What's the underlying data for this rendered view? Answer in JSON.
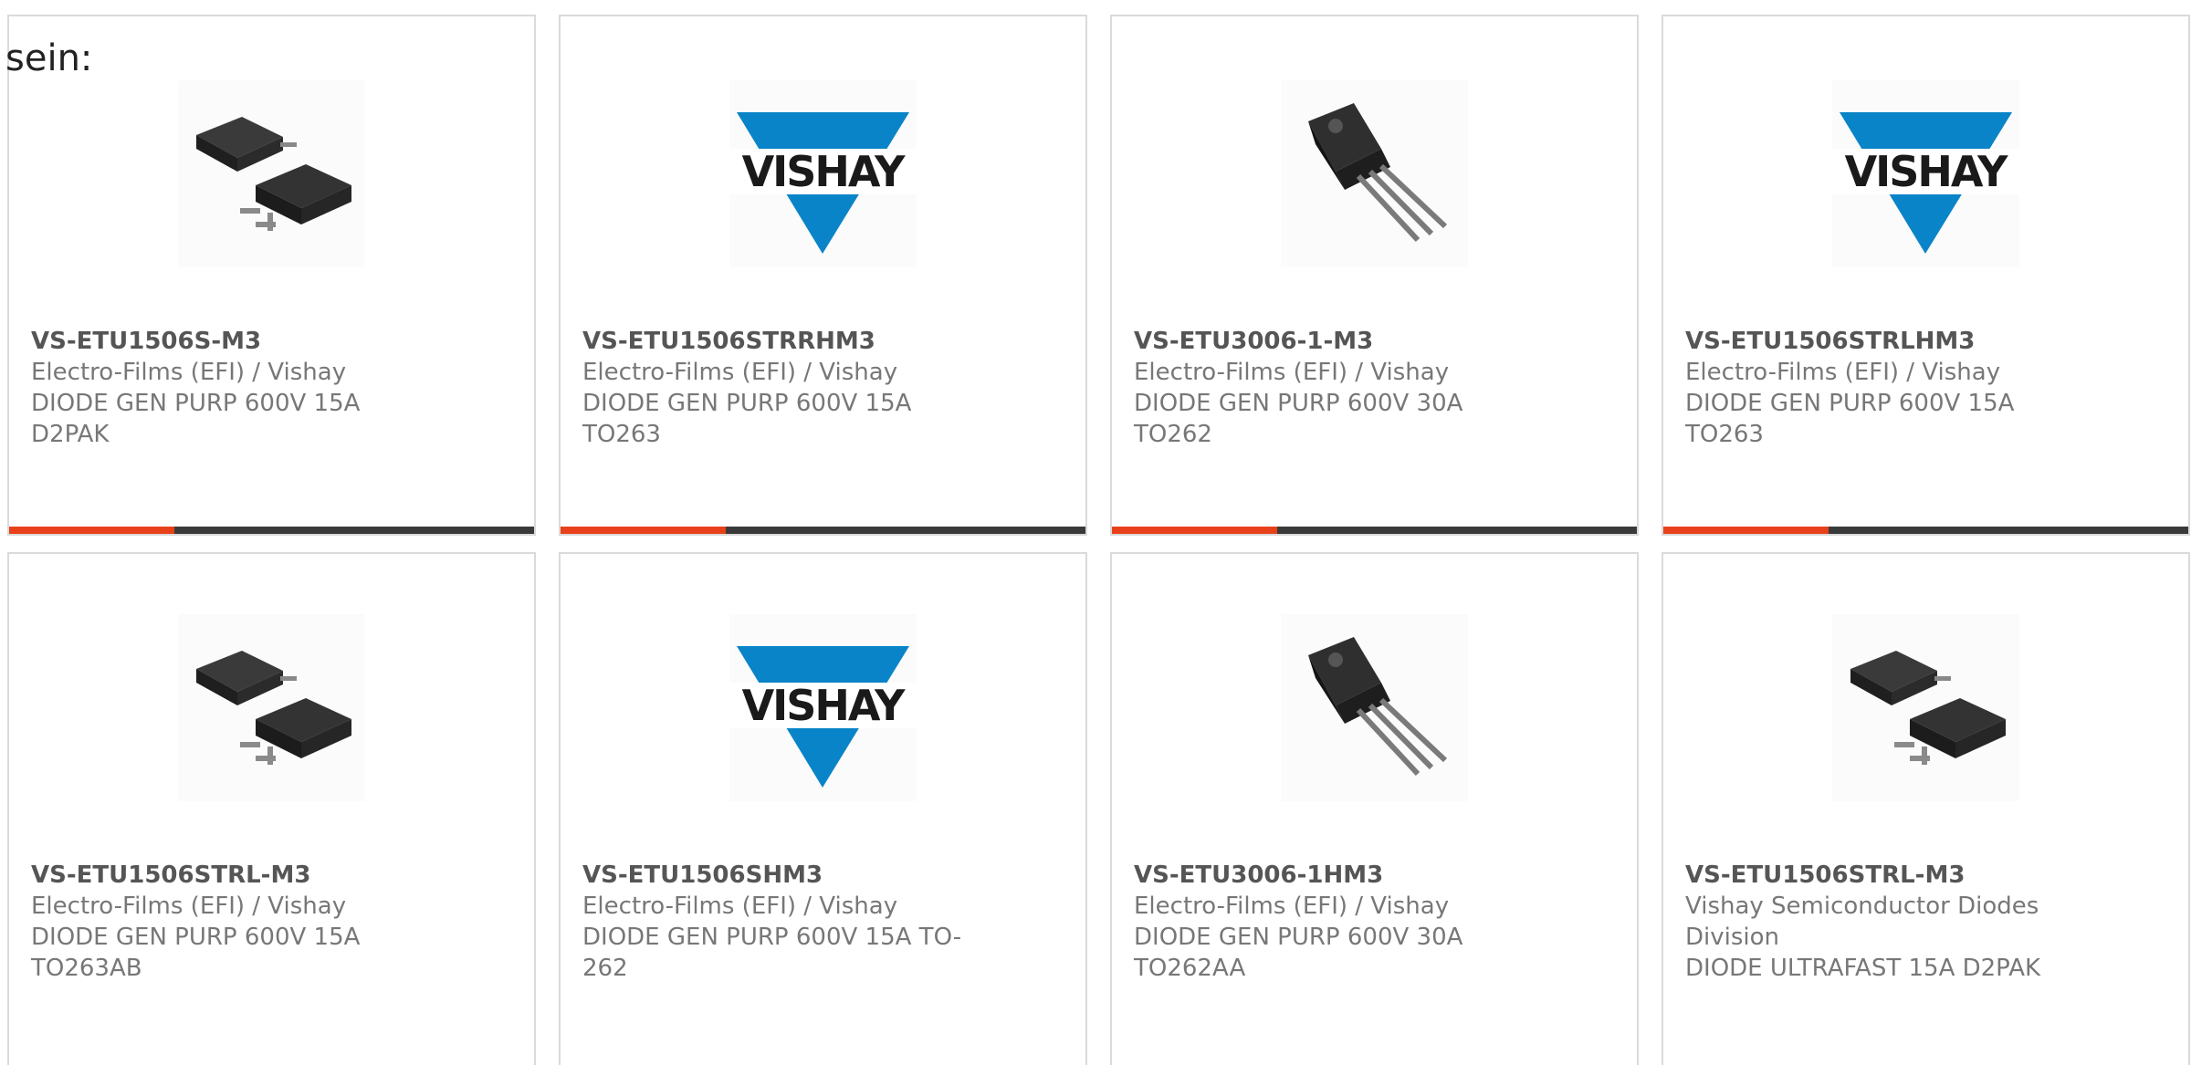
{
  "intro_text": "sein:",
  "colors": {
    "accent": "#e8411a",
    "bar": "#3a3a3a",
    "vishay_blue": "#0a84c8"
  },
  "products": [
    {
      "part_number": "VS-ETU1506S-M3",
      "manufacturer": "Electro-Films (EFI) / Vishay",
      "description_line1": "DIODE GEN PURP 600V 15A",
      "description_line2": "D2PAK",
      "image_icon": "d2pak-package-icon"
    },
    {
      "part_number": "VS-ETU1506STRRHM3",
      "manufacturer": "Electro-Films (EFI) / Vishay",
      "description_line1": "DIODE GEN PURP 600V 15A",
      "description_line2": "TO263",
      "image_icon": "vishay-logo"
    },
    {
      "part_number": "VS-ETU3006-1-M3",
      "manufacturer": "Electro-Films (EFI) / Vishay",
      "description_line1": "DIODE GEN PURP 600V 30A",
      "description_line2": "TO262",
      "image_icon": "to262-package-icon"
    },
    {
      "part_number": "VS-ETU1506STRLHM3",
      "manufacturer": "Electro-Films (EFI) / Vishay",
      "description_line1": "DIODE GEN PURP 600V 15A",
      "description_line2": "TO263",
      "image_icon": "vishay-logo"
    },
    {
      "part_number": "VS-ETU1506STRL-M3",
      "manufacturer": "Electro-Films (EFI) / Vishay",
      "description_line1": "DIODE GEN PURP 600V 15A",
      "description_line2": "TO263AB",
      "image_icon": "d2pak-package-icon"
    },
    {
      "part_number": "VS-ETU1506SHM3",
      "manufacturer": "Electro-Films (EFI) / Vishay",
      "description_line1": "DIODE GEN PURP 600V 15A TO-",
      "description_line2": "262",
      "image_icon": "vishay-logo"
    },
    {
      "part_number": "VS-ETU3006-1HM3",
      "manufacturer": "Electro-Films (EFI) / Vishay",
      "description_line1": "DIODE GEN PURP 600V 30A",
      "description_line2": "TO262AA",
      "image_icon": "to262-package-icon"
    },
    {
      "part_number": "VS-ETU1506STRL-M3",
      "manufacturer_line1": "Vishay Semiconductor Diodes",
      "manufacturer_line2": "Division",
      "description_line1": "DIODE ULTRAFAST 15A D2PAK",
      "image_icon": "d2pak-package-icon"
    }
  ],
  "vishay_logo_text": "VISHAY"
}
